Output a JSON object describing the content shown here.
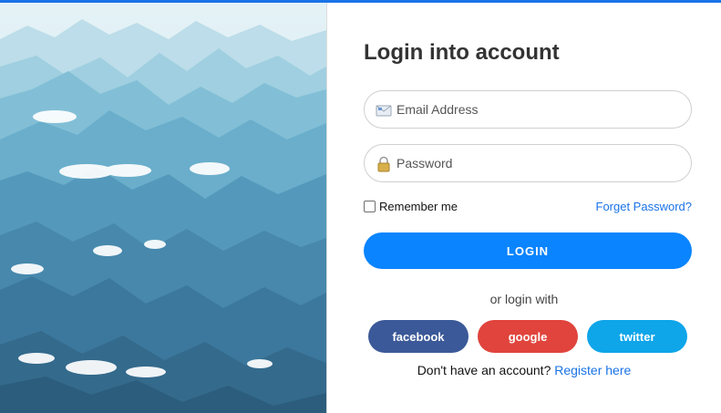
{
  "page": {
    "title": "Login into account"
  },
  "form": {
    "email_placeholder": "Email Address",
    "email_icon": "envelope-icon",
    "password_placeholder": "Password",
    "password_icon": "lock-icon",
    "remember_label": "Remember me",
    "remember_checked": false,
    "forgot_label": "Forget Password?",
    "login_label": "LOGIN"
  },
  "social": {
    "or_text": "or login with",
    "facebook_label": "facebook",
    "google_label": "google",
    "twitter_label": "twitter"
  },
  "register": {
    "prompt": "Don't have an account? ",
    "link_label": "Register here"
  },
  "colors": {
    "accent": "#0a84ff",
    "link": "#1a73e8",
    "facebook": "#3b5998",
    "google": "#e0443c",
    "twitter": "#0ea5e9",
    "top_bar": "#1a73e8"
  }
}
